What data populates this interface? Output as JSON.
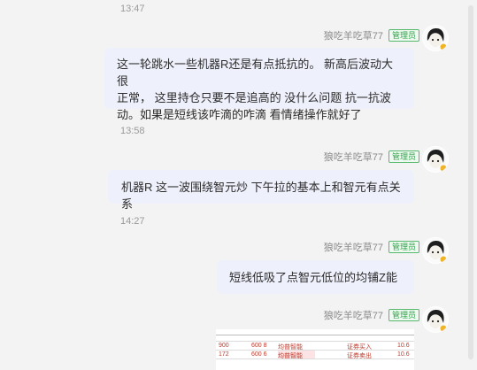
{
  "messages": [
    {
      "time": "13:47",
      "sender": "狼吃羊吃草77",
      "badge": "管理员",
      "lines": [
        "这一轮跳水一些机器R还是有点抵抗的。 新高后波动大很",
        "正常， 这里持仓只要不是追高的 没什么问题 抗一抗波",
        "动。如果是短线该咋滴的咋滴 看情绪操作就好了"
      ]
    },
    {
      "time": "13:58",
      "sender": "狼吃羊吃草77",
      "badge": "管理员",
      "lines": [
        "机器R 这一波围绕智元炒 下午拉的基本上和智元有点关系"
      ]
    },
    {
      "time": "14:27",
      "sender": "狼吃羊吃草77",
      "badge": "管理员",
      "lines": [
        "短线低吸了点智元低位的均铺Z能"
      ]
    },
    {
      "sender": "狼吃羊吃草77",
      "badge": "管理员",
      "image_rows": [
        [
          "900",
          "600 8",
          "均普智能",
          "证券买入",
          "10.6"
        ],
        [
          "172",
          "600 6",
          "均普智能",
          "证券卖出",
          "10.6"
        ]
      ]
    }
  ]
}
